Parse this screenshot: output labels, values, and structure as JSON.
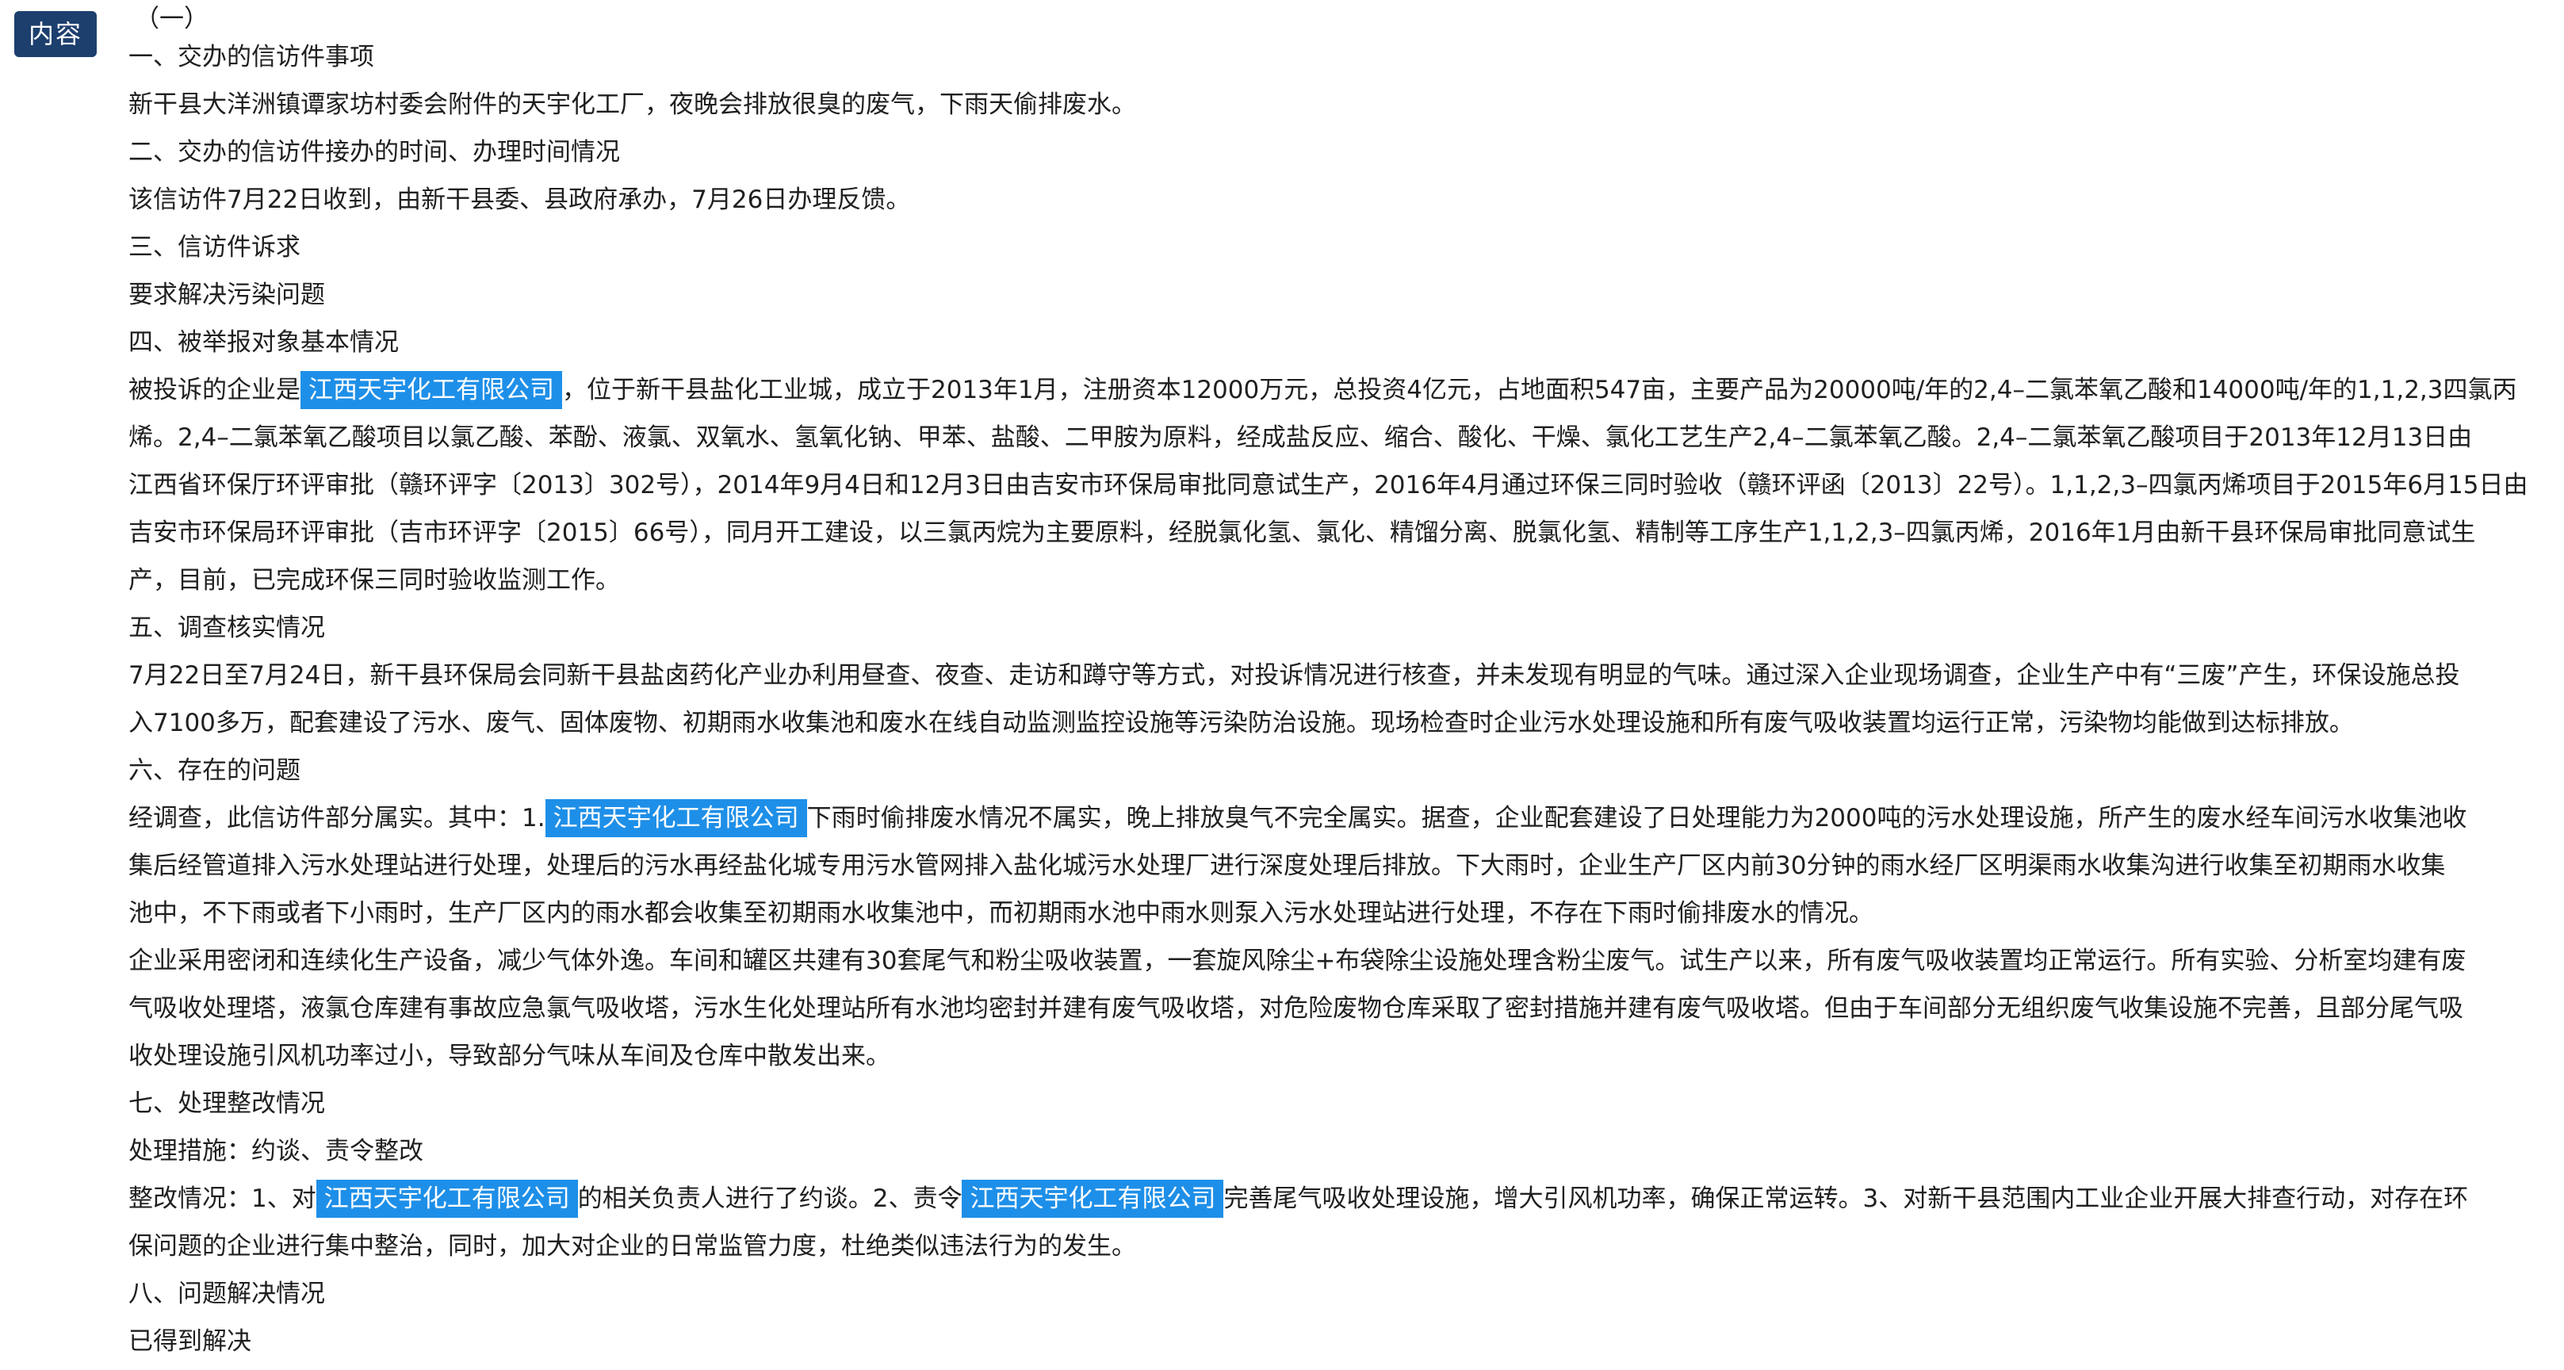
{
  "tag": "内容",
  "lines": [
    {
      "segments": [
        {
          "t": "（一）"
        }
      ]
    },
    {
      "segments": [
        {
          "t": "一、交办的信访件事项"
        }
      ]
    },
    {
      "segments": [
        {
          "t": "新干县大洋洲镇谭家坊村委会附件的天宇化工厂，夜晚会排放很臭的废气，下雨天偷排废水。"
        }
      ]
    },
    {
      "segments": [
        {
          "t": "二、交办的信访件接办的时间、办理时间情况"
        }
      ]
    },
    {
      "segments": [
        {
          "t": "该信访件7月22日收到，由新干县委、县政府承办，7月26日办理反馈。"
        }
      ]
    },
    {
      "segments": [
        {
          "t": "三、信访件诉求"
        }
      ]
    },
    {
      "segments": [
        {
          "t": "要求解决污染问题"
        }
      ]
    },
    {
      "segments": [
        {
          "t": "四、被举报对象基本情况"
        }
      ]
    },
    {
      "segments": [
        {
          "t": "被投诉的企业是"
        },
        {
          "t": "江西天宇化工有限公司",
          "hl": true
        },
        {
          "t": "，位于新干县盐化工业城，成立于2013年1月，注册资本12000万元，总投资4亿元，占地面积547亩，主要产品为20000吨/年的2,4–二氯苯氧乙酸和14000吨/年的1,1,2,3四氯丙"
        }
      ]
    },
    {
      "segments": [
        {
          "t": "烯。2,4–二氯苯氧乙酸项目以氯乙酸、苯酚、液氯、双氧水、氢氧化钠、甲苯、盐酸、二甲胺为原料，经成盐反应、缩合、酸化、干燥、氯化工艺生产2,4–二氯苯氧乙酸。2,4–二氯苯氧乙酸项目于2013年12月13日由"
        }
      ]
    },
    {
      "segments": [
        {
          "t": "江西省环保厅环评审批（赣环评字〔2013〕302号），2014年9月4日和12月3日由吉安市环保局审批同意试生产，2016年4月通过环保三同时验收（赣环评函〔2013〕22号）。1,1,2,3–四氯丙烯项目于2015年6月15日由"
        }
      ]
    },
    {
      "segments": [
        {
          "t": "吉安市环保局环评审批（吉市环评字〔2015〕66号），同月开工建设，以三氯丙烷为主要原料，经脱氯化氢、氯化、精馏分离、脱氯化氢、精制等工序生产1,1,2,3–四氯丙烯，2016年1月由新干县环保局审批同意试生"
        }
      ]
    },
    {
      "segments": [
        {
          "t": "产，目前，已完成环保三同时验收监测工作。"
        }
      ]
    },
    {
      "segments": [
        {
          "t": "五、调查核实情况"
        }
      ]
    },
    {
      "segments": [
        {
          "t": "7月22日至7月24日，新干县环保局会同新干县盐卤药化产业办利用昼查、夜查、走访和蹲守等方式，对投诉情况进行核查，并未发现有明显的气味。通过深入企业现场调查，企业生产中有“三废”产生，环保设施总投"
        }
      ]
    },
    {
      "segments": [
        {
          "t": "入7100多万，配套建设了污水、废气、固体废物、初期雨水收集池和废水在线自动监测监控设施等污染防治设施。现场检查时企业污水处理设施和所有废气吸收装置均运行正常，污染物均能做到达标排放。"
        }
      ]
    },
    {
      "segments": [
        {
          "t": "六、存在的问题"
        }
      ]
    },
    {
      "segments": [
        {
          "t": "经调查，此信访件部分属实。其中：1."
        },
        {
          "t": "江西天宇化工有限公司",
          "hl": true
        },
        {
          "t": "下雨时偷排废水情况不属实，晚上排放臭气不完全属实。据查，企业配套建设了日处理能力为2000吨的污水处理设施，所产生的废水经车间污水收集池收"
        }
      ]
    },
    {
      "segments": [
        {
          "t": "集后经管道排入污水处理站进行处理，处理后的污水再经盐化城专用污水管网排入盐化城污水处理厂进行深度处理后排放。下大雨时，企业生产厂区内前30分钟的雨水经厂区明渠雨水收集沟进行收集至初期雨水收集"
        }
      ]
    },
    {
      "segments": [
        {
          "t": "池中，不下雨或者下小雨时，生产厂区内的雨水都会收集至初期雨水收集池中，而初期雨水池中雨水则泵入污水处理站进行处理，不存在下雨时偷排废水的情况。"
        }
      ]
    },
    {
      "segments": [
        {
          "t": "企业采用密闭和连续化生产设备，减少气体外逸。车间和罐区共建有30套尾气和粉尘吸收装置，一套旋风除尘+布袋除尘设施处理含粉尘废气。试生产以来，所有废气吸收装置均正常运行。所有实验、分析室均建有废"
        }
      ]
    },
    {
      "segments": [
        {
          "t": "气吸收处理塔，液氯仓库建有事故应急氯气吸收塔，污水生化处理站所有水池均密封并建有废气吸收塔，对危险废物仓库采取了密封措施并建有废气吸收塔。但由于车间部分无组织废气收集设施不完善，且部分尾气吸"
        }
      ]
    },
    {
      "segments": [
        {
          "t": "收处理设施引风机功率过小，导致部分气味从车间及仓库中散发出来。"
        }
      ]
    },
    {
      "segments": [
        {
          "t": "七、处理整改情况"
        }
      ]
    },
    {
      "segments": [
        {
          "t": "处理措施：约谈、责令整改"
        }
      ]
    },
    {
      "segments": [
        {
          "t": "整改情况：1、对"
        },
        {
          "t": "江西天宇化工有限公司",
          "hl": true
        },
        {
          "t": "的相关负责人进行了约谈。2、责令"
        },
        {
          "t": "江西天宇化工有限公司",
          "hl": true
        },
        {
          "t": "完善尾气吸收处理设施，增大引风机功率，确保正常运转。3、对新干县范围内工业企业开展大排查行动，对存在环"
        }
      ]
    },
    {
      "segments": [
        {
          "t": "保问题的企业进行集中整治，同时，加大对企业的日常监管力度，杜绝类似违法行为的发生。"
        }
      ]
    },
    {
      "segments": [
        {
          "t": "八、问题解决情况"
        }
      ]
    },
    {
      "segments": [
        {
          "t": "已得到解决"
        }
      ]
    }
  ]
}
